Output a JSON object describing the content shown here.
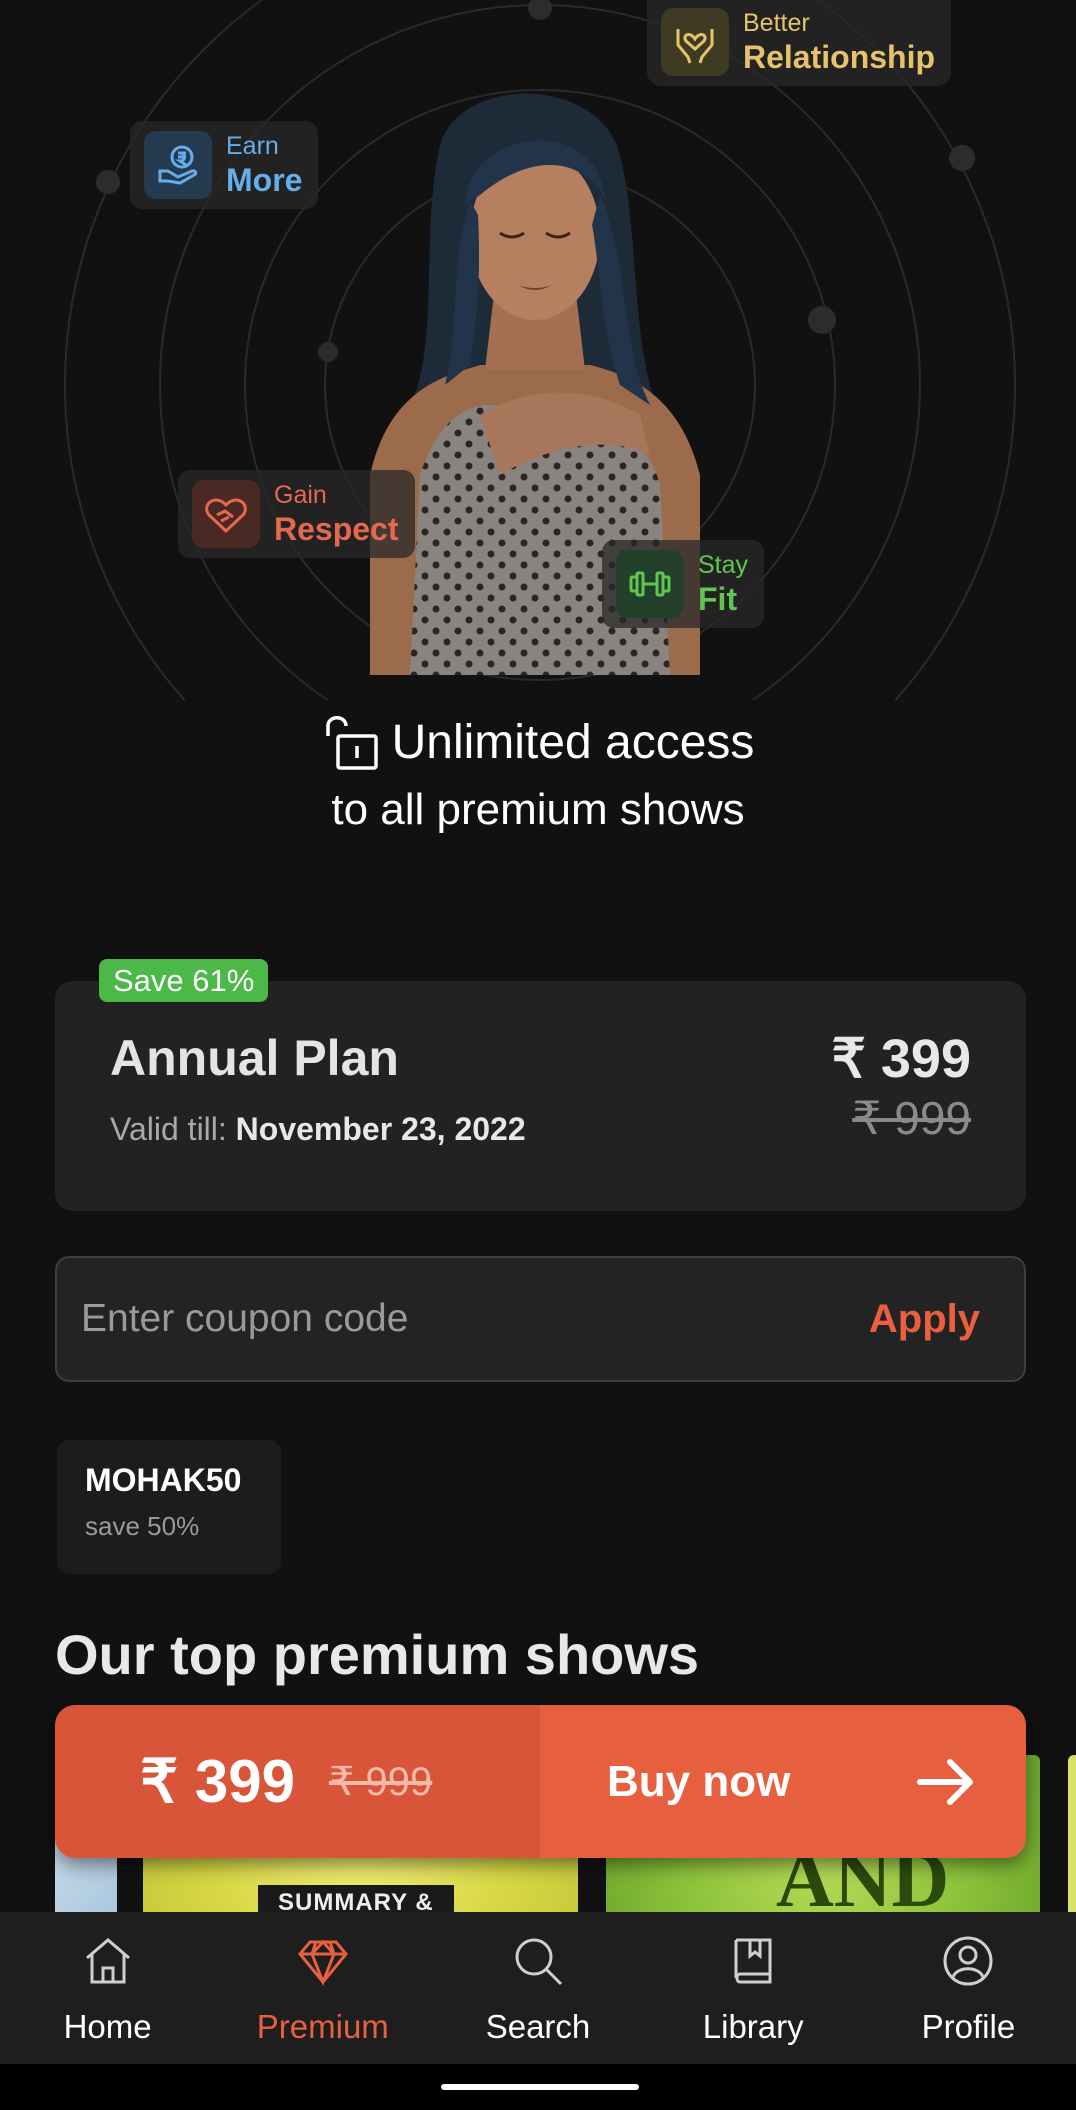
{
  "hero": {
    "chips": {
      "earn": {
        "line1": "Earn",
        "line2": "More",
        "icon": "hand-rupee-icon"
      },
      "relationship": {
        "line1": "Better",
        "line2": "Relationship",
        "icon": "hands-heart-icon"
      },
      "respect": {
        "line1": "Gain",
        "line2": "Respect",
        "icon": "handshake-heart-icon"
      },
      "fit": {
        "line1": "Stay",
        "line2": "Fit",
        "icon": "dumbbell-icon"
      }
    }
  },
  "headline": {
    "line1": "Unlimited access",
    "line2": "to all premium shows",
    "icon": "unlock-icon"
  },
  "plan": {
    "badge": "Save 61%",
    "name": "Annual Plan",
    "valid_prefix": "Valid till: ",
    "valid_date": "November 23, 2022",
    "price": "₹ 399",
    "old_price": "₹ 999"
  },
  "coupon": {
    "placeholder": "Enter coupon code",
    "value": "",
    "apply_label": "Apply"
  },
  "offer": {
    "code": "MOHAK50",
    "description": "save 50%"
  },
  "top_shows": {
    "title": "Our top premium shows",
    "thumb_tag": "SUMMARY &",
    "thumb_words": "AND"
  },
  "buy_bar": {
    "price": "₹ 399",
    "old_price": "₹ 999",
    "label": "Buy now",
    "icon": "arrow-right-icon"
  },
  "nav": {
    "items": [
      {
        "label": "Home",
        "icon": "home-icon",
        "active": false
      },
      {
        "label": "Premium",
        "icon": "diamond-icon",
        "active": true
      },
      {
        "label": "Search",
        "icon": "search-icon",
        "active": false
      },
      {
        "label": "Library",
        "icon": "book-icon",
        "active": false
      },
      {
        "label": "Profile",
        "icon": "profile-icon",
        "active": false
      }
    ]
  },
  "colors": {
    "accent": "#e8603f",
    "background": "#111111",
    "card": "#222222",
    "save_badge": "#4cb848"
  }
}
